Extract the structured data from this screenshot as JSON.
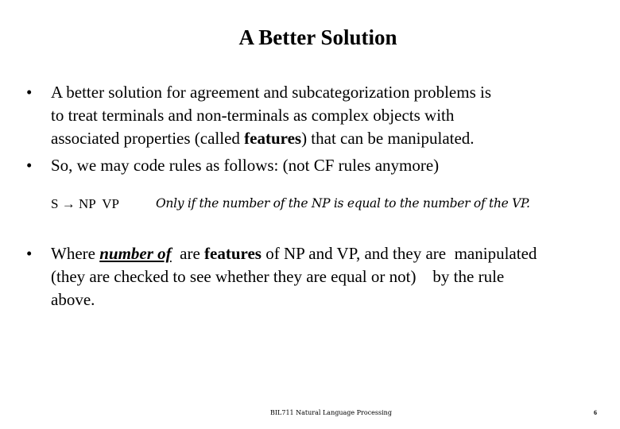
{
  "slide": {
    "title": "A Better Solution",
    "bullet_char": "•",
    "bullets": [
      {
        "lines": [
          "A better solution for agreement and subcategorization problems is",
          "to treat terminals and non-terminals as complex objects with",
          {
            "pre": "associated properties (called ",
            "bold": "features",
            "post": ") that can be manipulated."
          }
        ]
      },
      {
        "lines": [
          "So, we may code rules as follows: (not CF rules anymore)"
        ]
      },
      {
        "lines": [
          {
            "pre": "Where ",
            "underline": "number of",
            "mid": "  are ",
            "bold": "features",
            "post": " of NP and VP, and they are  manipulated"
          },
          "(they are checked to see whether they are equal or not)    by the rule",
          "above."
        ]
      }
    ],
    "rule": {
      "lhs": "S",
      "arrow": "→",
      "rhs": "NP  VP",
      "condition": "Only if the number of the NP is equal to the number of the VP."
    },
    "footer": {
      "course": "BIL711  Natural Language Processing",
      "page_number": "6"
    }
  }
}
